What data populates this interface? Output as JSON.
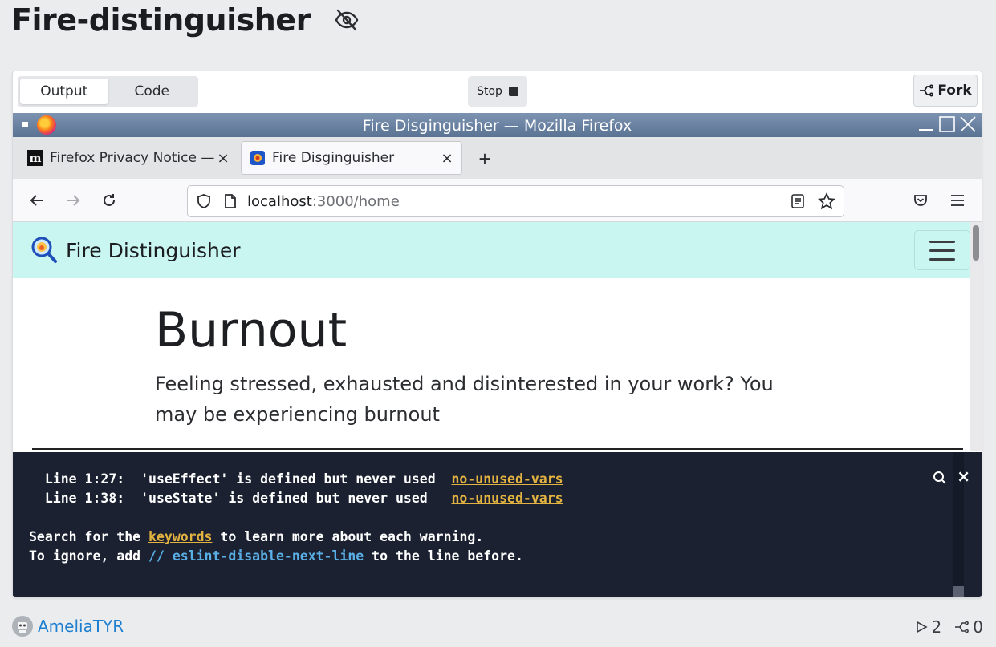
{
  "page": {
    "title": "Fire-distinguisher"
  },
  "toolbar": {
    "output_label": "Output",
    "code_label": "Code",
    "stop_label": "Stop",
    "fork_label": "Fork"
  },
  "firefox": {
    "window_title": "Fire Disginguisher — Mozilla Firefox",
    "tabs": [
      {
        "label": "Firefox Privacy Notice — F",
        "close": "×"
      },
      {
        "label": "Fire Disginguisher",
        "close": "×"
      }
    ],
    "new_tab": "+",
    "url_host": "localhost",
    "url_path": ":3000/home"
  },
  "app": {
    "brand": "Fire Distinguisher",
    "hero_title": "Burnout",
    "hero_text": "Feeling stressed, exhausted and disinterested in your work? You may be experiencing burnout"
  },
  "terminal": {
    "warnings": [
      {
        "prefix": "  Line 1:27:  'useEffect' is defined but never used  ",
        "rule": "no-unused-vars"
      },
      {
        "prefix": "  Line 1:38:  'useState' is defined but never used   ",
        "rule": "no-unused-vars"
      }
    ],
    "search_prefix": "Search for the ",
    "search_link": "keywords",
    "search_suffix": " to learn more about each warning.",
    "ignore_prefix": "To ignore, add ",
    "ignore_comment": "// eslint-disable-next-line",
    "ignore_suffix": " to the line before.",
    "close": "×"
  },
  "footer": {
    "username": "AmeliaTYR",
    "runs": "2",
    "forks": "0"
  },
  "colors": {
    "app_nav_bg": "#c9f6f1",
    "terminal_bg": "#1b2131",
    "link_yellow": "#e3b341",
    "comment_blue": "#5ab0e6",
    "username_blue": "#1e7fd1"
  }
}
